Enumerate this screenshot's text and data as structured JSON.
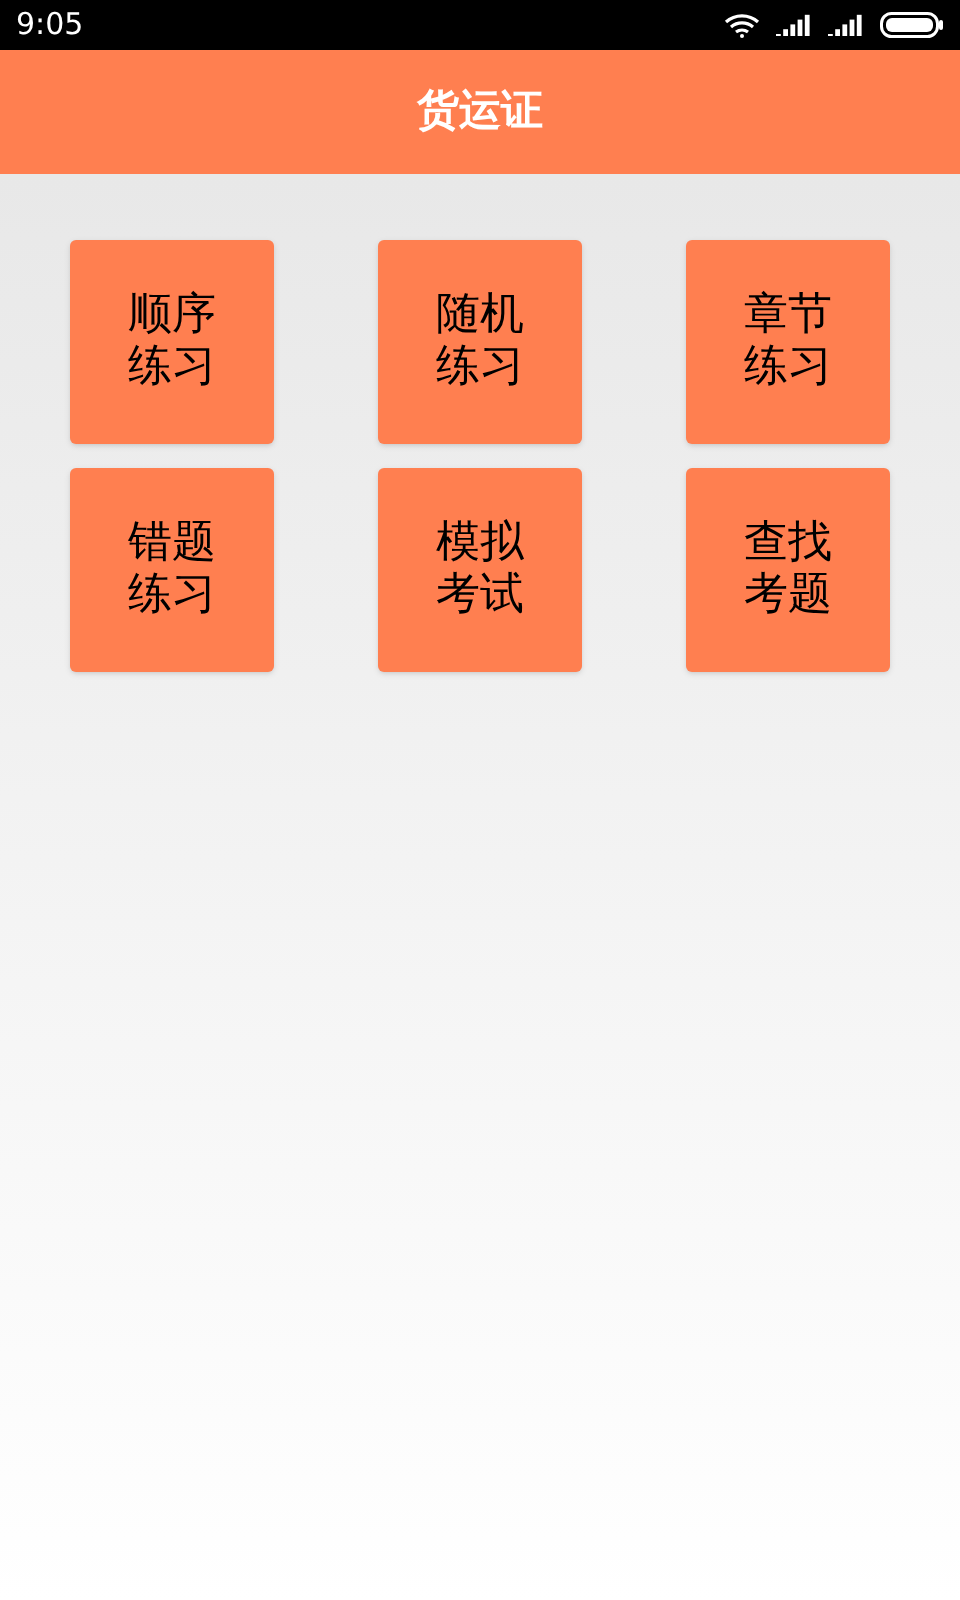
{
  "status_bar": {
    "time": "9:05"
  },
  "header": {
    "title": "货运证"
  },
  "tiles": [
    {
      "label": "顺序练习"
    },
    {
      "label": "随机练习"
    },
    {
      "label": "章节练习"
    },
    {
      "label": "错题练习"
    },
    {
      "label": "模拟考试"
    },
    {
      "label": "查找考题"
    }
  ]
}
